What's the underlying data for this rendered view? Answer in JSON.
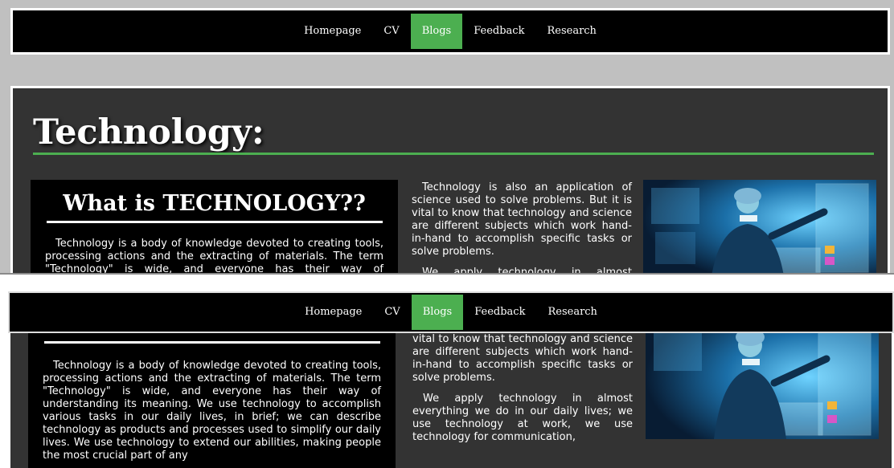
{
  "nav": {
    "items": [
      {
        "label": "Homepage"
      },
      {
        "label": "CV"
      },
      {
        "label": "Blogs",
        "active": true
      },
      {
        "label": "Feedback"
      },
      {
        "label": "Research"
      }
    ]
  },
  "page": {
    "heading": "Technology:"
  },
  "card": {
    "title": "What is TECHNOLOGY??",
    "body": "Technology is a body of knowledge devoted to creating tools, processing actions and the extracting of materials. The term \"Technology\" is wide, and everyone has their way of understanding its meaning. We use technology to accomplish various tasks in our daily lives, in brief; we can describe technology as products and processes used to simplify our daily lives. We use technology to extend our abilities, making people the most crucial part of any"
  },
  "middle": {
    "p1": "Technology is also an application of science used to solve problems. But it is vital to know that technology and science are different subjects which work hand-in-hand to accomplish specific tasks or solve problems.",
    "p2": "We apply technology in almost everything we do in our daily lives; we use technology at work, we use technology for communication,"
  },
  "colors": {
    "accent": "#4caf50",
    "nav_bg": "#000000",
    "content_bg": "#333333",
    "outer_bg": "#c0c0c0"
  },
  "image": {
    "description_icon": "medical-technology-photo"
  }
}
